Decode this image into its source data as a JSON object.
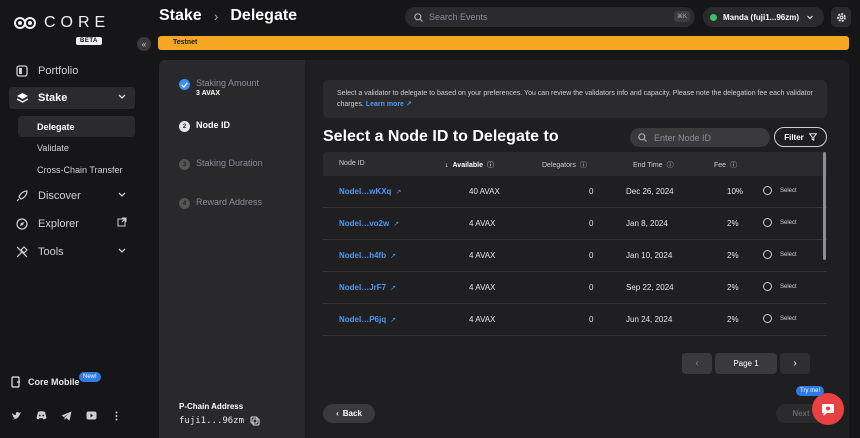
{
  "sidebar": {
    "logo_text": "CORE",
    "beta_label": "BETA",
    "items": [
      {
        "label": "Portfolio",
        "icon": "portfolio-icon"
      },
      {
        "label": "Stake",
        "icon": "stake-icon"
      },
      {
        "label": "Discover",
        "icon": "rocket-icon"
      },
      {
        "label": "Explorer",
        "icon": "compass-icon"
      },
      {
        "label": "Tools",
        "icon": "tools-icon"
      }
    ],
    "stake_sub": [
      {
        "label": "Delegate"
      },
      {
        "label": "Validate"
      },
      {
        "label": "Cross-Chain Transfer"
      }
    ],
    "core_mobile": "Core Mobile",
    "new_badge": "New!"
  },
  "header": {
    "crumb_root": "Stake",
    "crumb_sep": "›",
    "crumb_current": "Delegate",
    "search_placeholder": "Search Events",
    "search_shortcut": "⌘K",
    "account_label": "Manda (fuji1...96zm)"
  },
  "banner": {
    "label": "Testnet"
  },
  "steps": [
    {
      "number": "",
      "label": "Staking Amount",
      "sub": "3 AVAX",
      "state": "done"
    },
    {
      "number": "2",
      "label": "Node ID",
      "sub": "",
      "state": "current"
    },
    {
      "number": "3",
      "label": "Staking Duration",
      "sub": "",
      "state": "pending"
    },
    {
      "number": "4",
      "label": "Reward Address",
      "sub": "",
      "state": "pending"
    }
  ],
  "pchain": {
    "label": "P-Chain Address",
    "value": "fuji1...96zm"
  },
  "info": {
    "text": "Select a validator to delegate to based on your preferences. You can review the validators info and capacity. Please note the delegation fee each validator charges.",
    "link": "Learn more"
  },
  "section_title": "Select a Node ID to Delegate to",
  "node_search_placeholder": "Enter Node ID",
  "filter_label": "Filter",
  "table": {
    "headers": {
      "node_id": "Node ID",
      "available": "Available",
      "delegators": "Delegators",
      "end_time": "End Time",
      "fee": "Fee"
    },
    "rows": [
      {
        "node": "NodeI…wKXq",
        "available": "40 AVAX",
        "delegators": "0",
        "end": "Dec 26, 2024",
        "fee": "10%",
        "select": "Select"
      },
      {
        "node": "NodeI…vo2w",
        "available": "4 AVAX",
        "delegators": "0",
        "end": "Jan 8, 2024",
        "fee": "2%",
        "select": "Select"
      },
      {
        "node": "NodeI…h4fb",
        "available": "4 AVAX",
        "delegators": "0",
        "end": "Jan 10, 2024",
        "fee": "2%",
        "select": "Select"
      },
      {
        "node": "NodeI…JrF7",
        "available": "4 AVAX",
        "delegators": "0",
        "end": "Sep 22, 2024",
        "fee": "2%",
        "select": "Select"
      },
      {
        "node": "NodeI…P6jq",
        "available": "4 AVAX",
        "delegators": "0",
        "end": "Jun 24, 2024",
        "fee": "2%",
        "select": "Select"
      }
    ]
  },
  "pager": {
    "page_label": "Page 1",
    "prev": "‹",
    "next": "›"
  },
  "back_label": "Back",
  "next_label": "Next",
  "try_me": "Try me!",
  "colors": {
    "accent": "#3a8ff5",
    "link": "#4a9af5",
    "testnet": "#f5a623",
    "chat": "#e84142",
    "online": "#3bbf6a"
  }
}
